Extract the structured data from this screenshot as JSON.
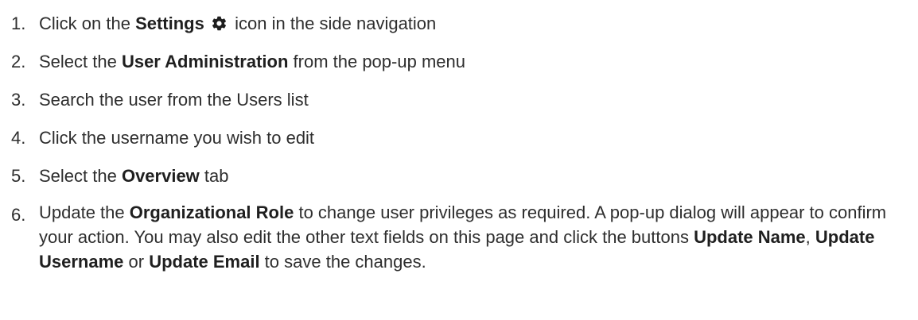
{
  "steps": [
    {
      "number": "1.",
      "pre": "Click on the ",
      "bold": "Settings",
      "icon": "gear-icon",
      "post": " icon in the side navigation"
    },
    {
      "number": "2.",
      "pre": "Select the ",
      "bold": "User Administration",
      "post": " from the pop-up menu"
    },
    {
      "number": "3.",
      "text": "Search the user from the Users list"
    },
    {
      "number": "4.",
      "text": "Click the username you wish to edit"
    },
    {
      "number": "5.",
      "pre": "Select the ",
      "bold": "Overview",
      "post": " tab"
    },
    {
      "number": "6.",
      "pre": "Update the ",
      "bold": "Organizational Role",
      "mid": " to change user privileges as required. A pop-up dialog will appear to confirm your action. You may also edit the other text fields on this page and click the buttons ",
      "btn1": "Update Name",
      "sep1": ", ",
      "btn2": "Update Username",
      "sep2": " or ",
      "btn3": "Update Email",
      "post": " to save the changes."
    }
  ],
  "colors": {
    "text": "#2e2e2e",
    "icon": "#1f1f1f"
  }
}
